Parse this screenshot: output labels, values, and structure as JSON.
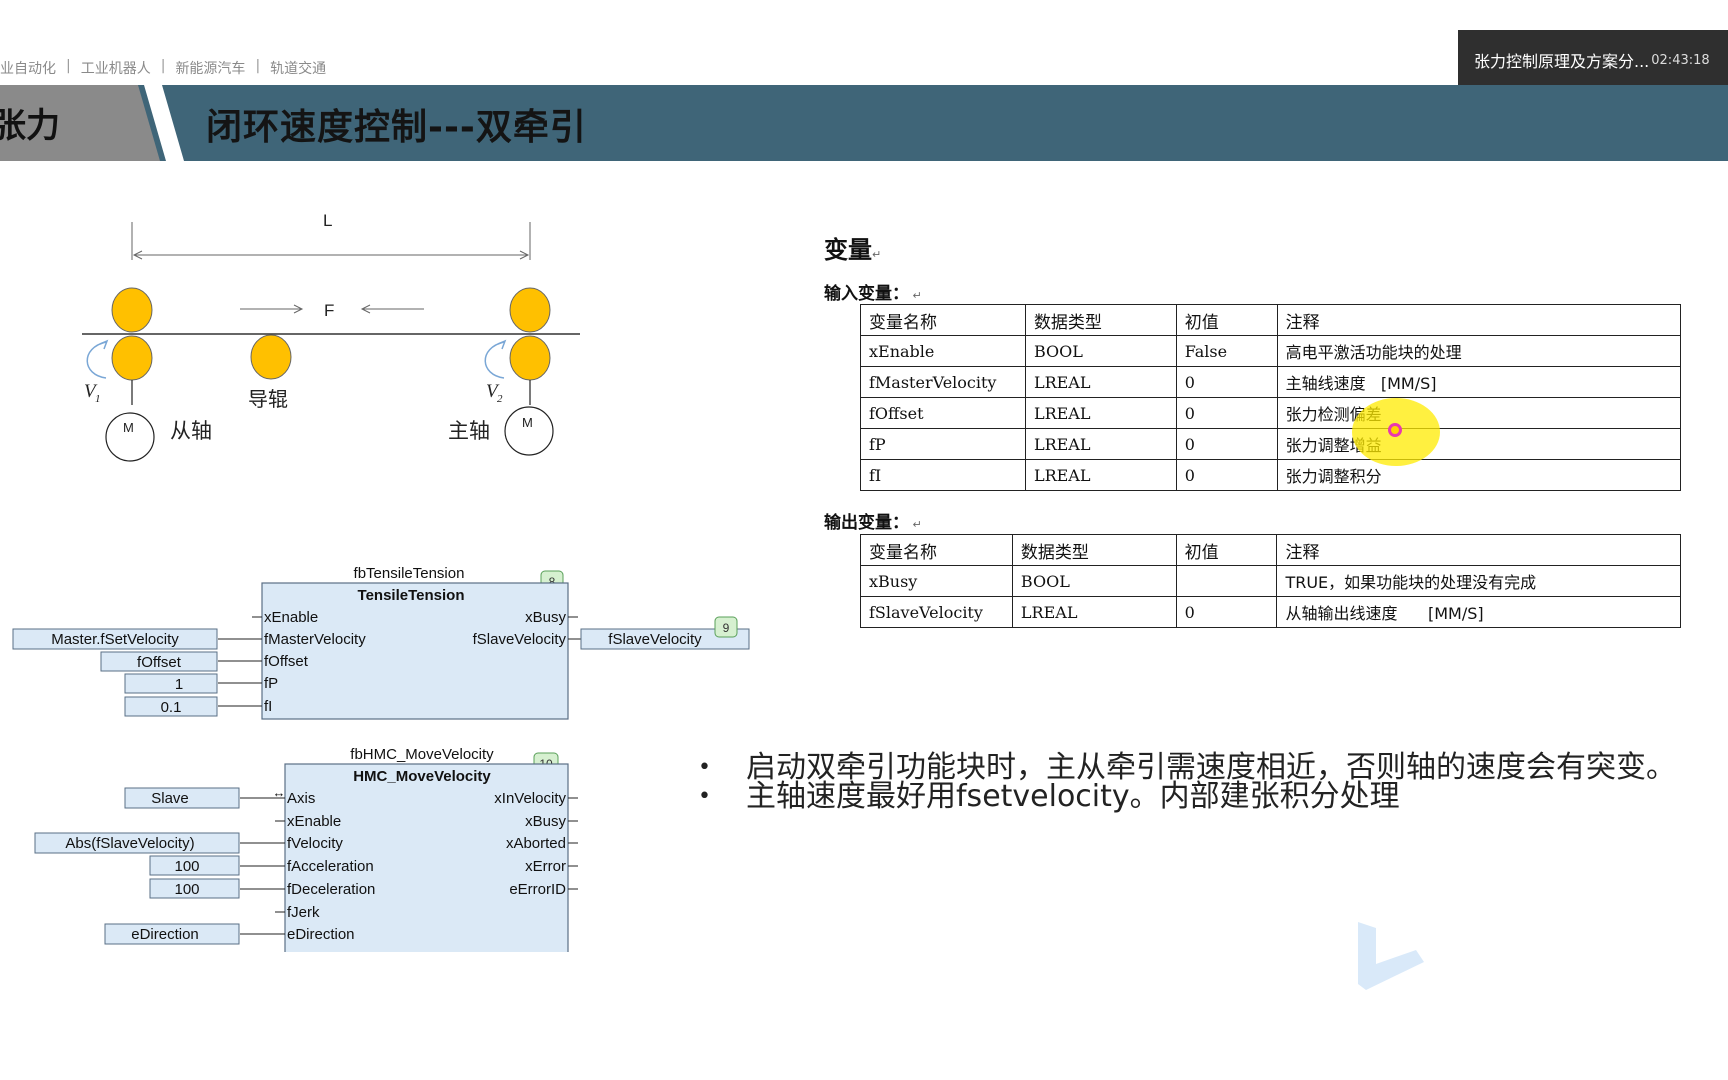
{
  "nav": {
    "items": [
      "工业自动化",
      "工业机器人",
      "新能源汽车",
      "轨道交通"
    ],
    "separator": "|"
  },
  "video_overlay": {
    "title": "张力控制原理及方案分...",
    "time": "02:43:18"
  },
  "banner": {
    "left_label": "张力",
    "title": "闭环速度控制---双牵引"
  },
  "diagram": {
    "length_label": "L",
    "force_label": "F",
    "guide_roller": "导辊",
    "slave_axis": "从轴",
    "master_axis": "主轴",
    "motor_label": "M",
    "v1": "V",
    "v1_sub": "1",
    "v2": "V",
    "v2_sub": "2"
  },
  "fb1": {
    "instance": "fbTensileTension",
    "type": "TensileTension",
    "order": "8",
    "inputs": [
      "xEnable",
      "fMasterVelocity",
      "fOffset",
      "fP",
      "fI"
    ],
    "outputs": [
      "xBusy",
      "fSlaveVelocity"
    ],
    "input_values": [
      "Master.fSetVelocity",
      "fOffset",
      "1",
      "0.1"
    ],
    "output_value": "fSlaveVelocity",
    "output_order": "9"
  },
  "fb2": {
    "instance": "fbHMC_MoveVelocity",
    "type": "HMC_MoveVelocity",
    "order": "10",
    "inputs": [
      "Axis",
      "xEnable",
      "fVelocity",
      "fAcceleration",
      "fDeceleration",
      "fJerk",
      "eDirection"
    ],
    "outputs": [
      "xInVelocity",
      "xBusy",
      "xAborted",
      "xError",
      "eErrorID"
    ],
    "input_values": [
      "Slave",
      "Abs(fSlaveVelocity)",
      "100",
      "100",
      "eDirection"
    ],
    "axis_arrow": "↔"
  },
  "variables": {
    "title": "变量",
    "input_title": "输入变量：",
    "output_title": "输出变量：",
    "headers": [
      "变量名称",
      "数据类型",
      "初值",
      "注释"
    ],
    "inputs": [
      [
        "xEnable",
        "BOOL",
        "False",
        "高电平激活功能块的处理"
      ],
      [
        "fMasterVelocity",
        "LREAL",
        "0",
        "主轴线速度   [MM/S]"
      ],
      [
        "fOffset",
        "LREAL",
        "0",
        "张力检测偏差"
      ],
      [
        "fP",
        "LREAL",
        "0",
        "张力调整增益"
      ],
      [
        "fI",
        "LREAL",
        "0",
        "张力调整积分"
      ]
    ],
    "outputs": [
      [
        "xBusy",
        "BOOL",
        "",
        "TRUE，如果功能块的处理没有完成"
      ],
      [
        "fSlaveVelocity",
        "LREAL",
        "0",
        "从轴输出线速度      [MM/S]"
      ]
    ]
  },
  "bullets": [
    "启动双牵引功能块时，主从牵引需速度相近，否则轴的速度会有突变。",
    "主轴速度最好用fsetvelocity。内部建张积分处理"
  ],
  "colors": {
    "banner": "#3f6578",
    "banner_tab": "#8a8a8a",
    "roller": "#ffc000",
    "fb_fill": "#dbe9f6",
    "fb_border": "#5a6f86",
    "order_badge": "#d6f0d0",
    "highlight": "#ffeb00"
  }
}
